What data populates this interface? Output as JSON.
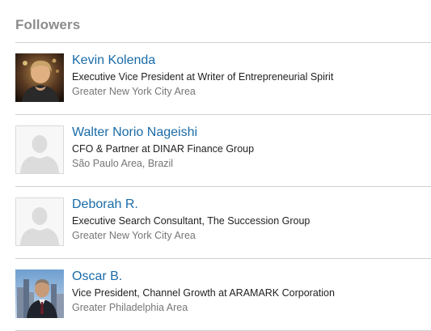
{
  "panel": {
    "title": "Followers"
  },
  "followers": [
    {
      "name": "Kevin Kolenda",
      "headline": "Executive Vice President at Writer of Entrepreneurial Spirit",
      "location": "Greater New York City Area",
      "avatar": "photo"
    },
    {
      "name": "Walter Norio Nageishi",
      "headline": "CFO & Partner at DINAR Finance Group",
      "location": "São Paulo Area, Brazil",
      "avatar": "placeholder"
    },
    {
      "name": "Deborah R.",
      "headline": "Executive Search Consultant, The Succession Group",
      "location": "Greater New York City Area",
      "avatar": "placeholder"
    },
    {
      "name": "Oscar B.",
      "headline": "Vice President, Channel Growth at ARAMARK Corporation",
      "location": "Greater Philadelphia Area",
      "avatar": "photo"
    }
  ],
  "colors": {
    "name_link": "#1a6ba8",
    "title": "#8c8c8c",
    "divider": "#cfcfcf",
    "location": "#767676"
  }
}
